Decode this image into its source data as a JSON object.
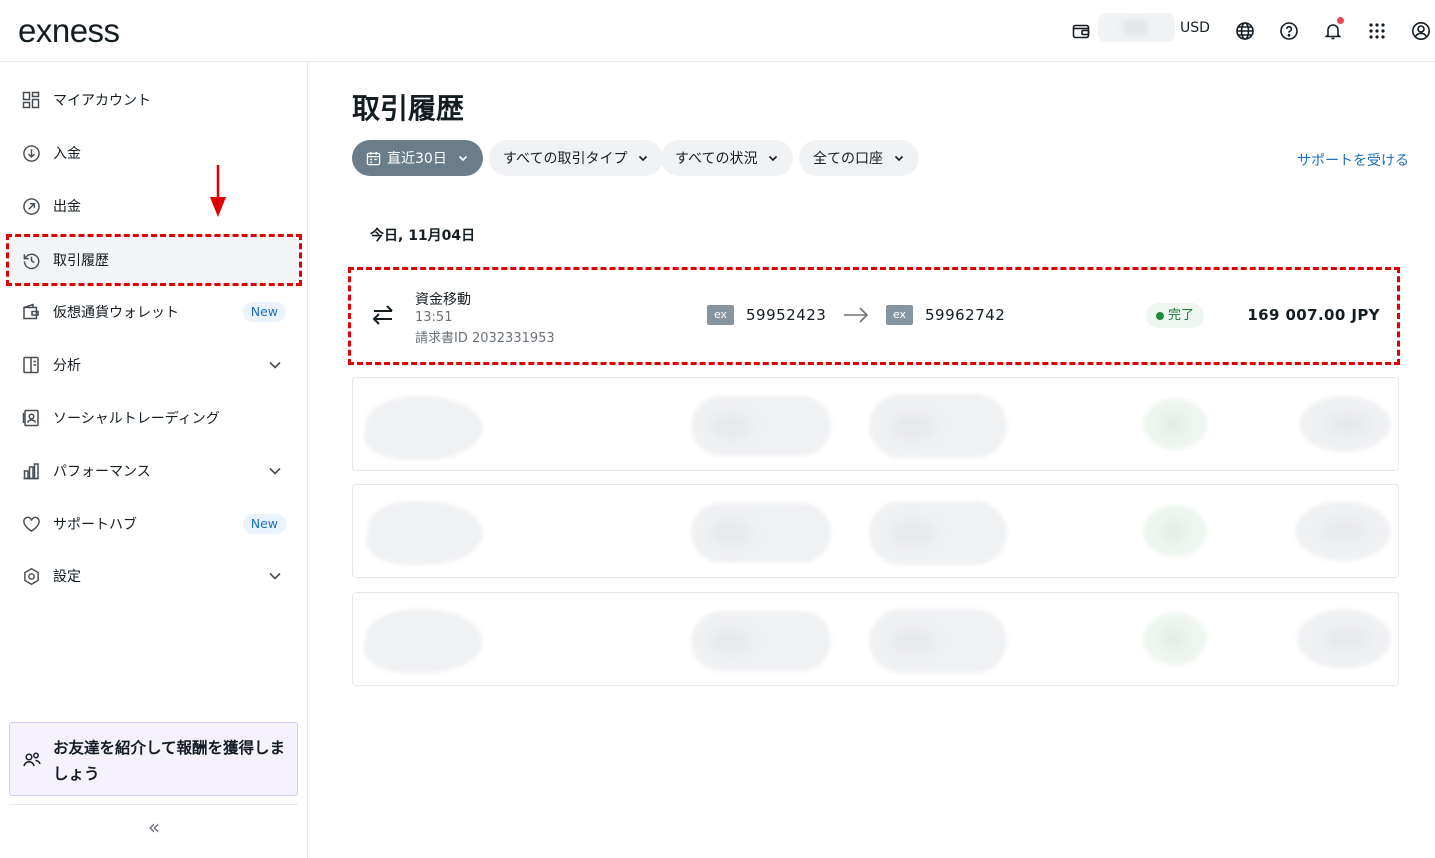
{
  "header": {
    "logo": "exness",
    "currency": "USD",
    "icons": [
      "wallet-icon",
      "globe-icon",
      "help-icon",
      "bell-icon",
      "apps-grid-icon",
      "profile-icon"
    ]
  },
  "sidebar": {
    "items": [
      {
        "label": "マイアカウント",
        "icon": "dashboard-icon"
      },
      {
        "label": "入金",
        "icon": "deposit-icon"
      },
      {
        "label": "出金",
        "icon": "withdraw-icon"
      },
      {
        "label": "取引履歴",
        "icon": "history-icon",
        "active": true
      },
      {
        "label": "仮想通貨ウォレット",
        "icon": "crypto-wallet-icon",
        "badge": "New"
      },
      {
        "label": "分析",
        "icon": "analytics-icon",
        "expandable": true
      },
      {
        "label": "ソーシャルトレーディング",
        "icon": "social-trading-icon"
      },
      {
        "label": "パフォーマンス",
        "icon": "performance-icon",
        "expandable": true
      },
      {
        "label": "サポートハブ",
        "icon": "heart-icon",
        "badge": "New"
      },
      {
        "label": "設定",
        "icon": "settings-icon",
        "expandable": true
      }
    ],
    "promo": "お友達を紹介して報酬を獲得しましょう",
    "collapse_glyph": "«"
  },
  "main": {
    "title": "取引履歴",
    "filters": [
      {
        "label": "直近30日",
        "active": true
      },
      {
        "label": "すべての取引タイプ"
      },
      {
        "label": "すべての状況"
      },
      {
        "label": "全ての口座"
      }
    ],
    "support_link": "サポートを受ける",
    "date_header": "今日, 11月04日",
    "transaction": {
      "type": "資金移動",
      "time": "13:51",
      "invoice_id": "請求書ID 2032331953",
      "from_badge": "ex",
      "from_account": "59952423",
      "to_badge": "ex",
      "to_account": "59962742",
      "status": "完了",
      "amount": "169 007.00 JPY"
    }
  },
  "colors": {
    "accent_blue": "#1e6fbf",
    "active_filter": "#6b7d88",
    "status_green": "#1c8a41",
    "highlight_red": "#e00000",
    "promo_bg": "#f6f1fe"
  }
}
